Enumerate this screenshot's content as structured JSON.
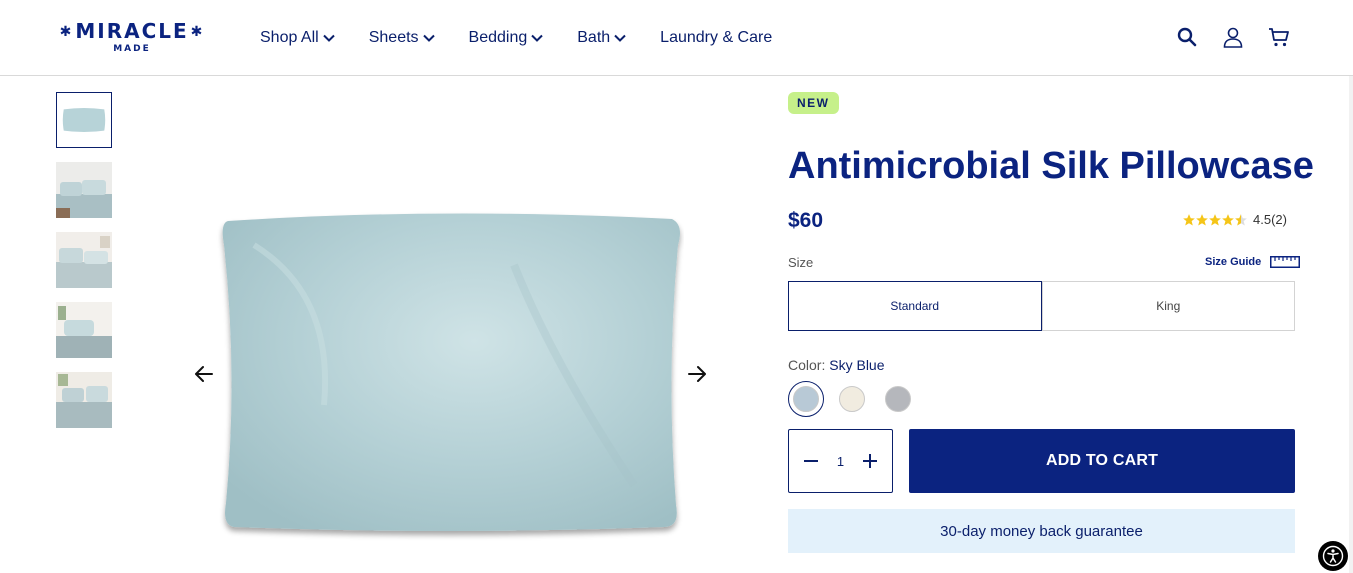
{
  "brand": {
    "name": "MIRACLE",
    "sub": "MADE"
  },
  "nav": [
    {
      "label": "Shop All",
      "dropdown": true
    },
    {
      "label": "Sheets",
      "dropdown": true
    },
    {
      "label": "Bedding",
      "dropdown": true
    },
    {
      "label": "Bath",
      "dropdown": true
    },
    {
      "label": "Laundry & Care",
      "dropdown": false
    }
  ],
  "header_icons": [
    "search-icon",
    "account-icon",
    "cart-icon"
  ],
  "gallery": {
    "thumbnail_count": 5,
    "active_index": 0,
    "prev_icon": "arrow-left-icon",
    "next_icon": "arrow-right-icon"
  },
  "product": {
    "badge": "NEW",
    "title": "Antimicrobial Silk Pillowcase",
    "price": "$60",
    "rating": {
      "value": 4.5,
      "display": "4.5",
      "count": "(2)"
    },
    "size": {
      "label": "Size",
      "guide_label": "Size Guide",
      "options": [
        "Standard",
        "King"
      ],
      "selected": "Standard"
    },
    "color": {
      "label": "Color:",
      "selected": "Sky Blue",
      "swatches": [
        {
          "name": "Sky Blue",
          "hex": "#b8c9d6"
        },
        {
          "name": "Ivory",
          "hex": "#f1ece0"
        },
        {
          "name": "Grey",
          "hex": "#b5b7bc"
        }
      ]
    },
    "quantity": "1",
    "add_to_cart": "ADD TO CART",
    "guarantee": "30-day money back guarantee"
  },
  "colors": {
    "brand_navy": "#0b2380",
    "badge_green": "#c6f08a",
    "guarantee_bg": "#e3f1fb",
    "star_yellow": "#f5c518"
  }
}
